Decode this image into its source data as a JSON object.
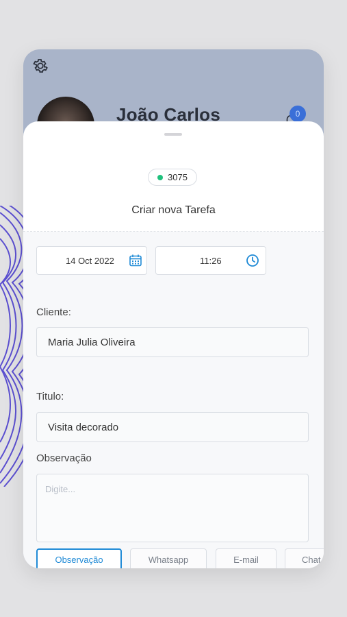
{
  "header": {
    "user_name": "João Carlos",
    "notification_count": "0"
  },
  "task": {
    "code": "3075",
    "code_status_color": "#20c17d",
    "title": "Criar nova Tarefa",
    "date": "14 Oct 2022",
    "time": "11:26"
  },
  "form": {
    "client_label": "Cliente:",
    "client_value": "Maria Julia Oliveira",
    "title_label": "Titulo:",
    "title_value": "Visita decorado",
    "observation_label": "Observação",
    "observation_placeholder": "Digite..."
  },
  "tabs": [
    {
      "label": "Observação",
      "active": true
    },
    {
      "label": "Whatsapp",
      "active": false
    },
    {
      "label": "E-mail",
      "active": false
    },
    {
      "label": "Chat",
      "active": false
    }
  ],
  "colors": {
    "accent": "#1f8ad6",
    "header_bg": "#a9b4c9",
    "badge": "#3a6fd8"
  }
}
